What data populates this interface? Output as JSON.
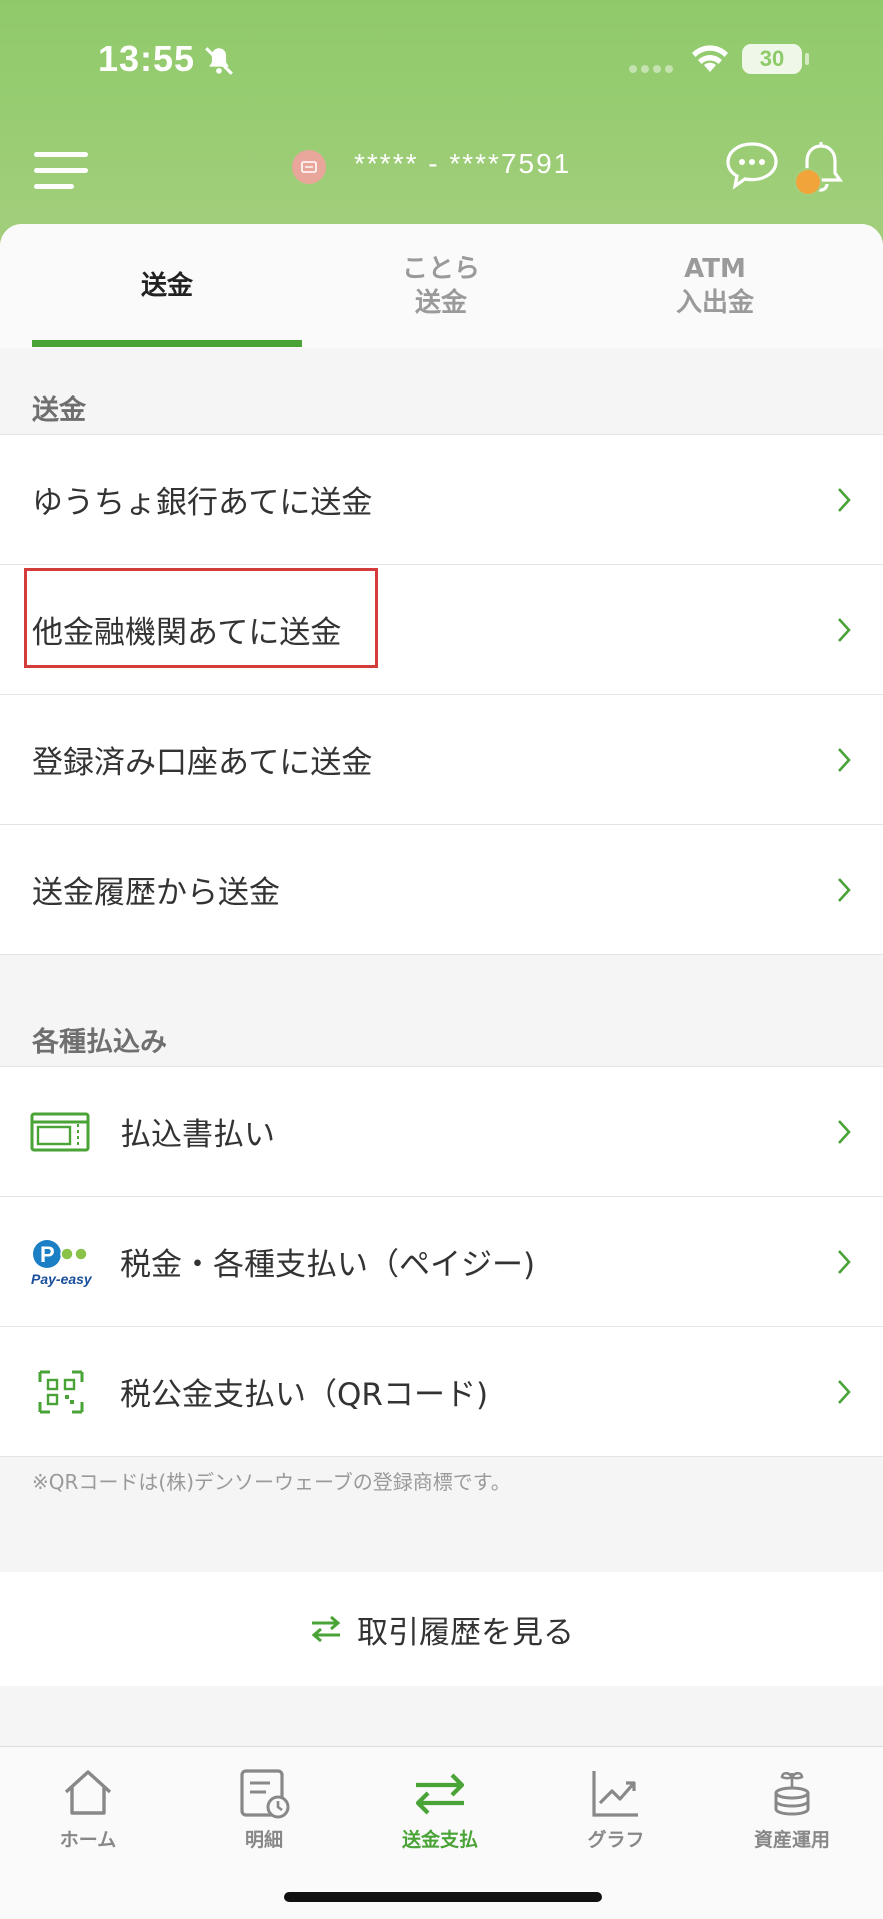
{
  "status_bar": {
    "time": "13:55",
    "battery": "30"
  },
  "header": {
    "account_number": "***** - ****7591"
  },
  "tabs": [
    {
      "label": "送金"
    },
    {
      "label": "ことら\n送金"
    },
    {
      "label": "ATM\n入出金"
    }
  ],
  "sections": {
    "transfer": {
      "title": "送金",
      "items": [
        {
          "label": "ゆうちょ銀行あてに送金"
        },
        {
          "label": "他金融機関あてに送金"
        },
        {
          "label": "登録済み口座あてに送金"
        },
        {
          "label": "送金履歴から送金"
        }
      ]
    },
    "payments": {
      "title": "各種払込み",
      "items": [
        {
          "label": "払込書払い",
          "icon": "payment-slip-icon"
        },
        {
          "label": "税金・各種支払い（ペイジー)",
          "icon": "pay-easy-logo"
        },
        {
          "label": "税公金支払い（QRコード)",
          "icon": "qr-code-icon"
        }
      ]
    }
  },
  "logo_text": "Pay-easy",
  "note": "※QRコードは(株)デンソーウェーブの登録商標です。",
  "history_link": {
    "label": "取引履歴を見る"
  },
  "bottom_nav": [
    {
      "label": "ホーム",
      "icon": "home-icon"
    },
    {
      "label": "明細",
      "icon": "statement-icon"
    },
    {
      "label": "送金支払",
      "icon": "transfer-icon"
    },
    {
      "label": "グラフ",
      "icon": "graph-icon"
    },
    {
      "label": "資産運用",
      "icon": "asset-icon"
    }
  ],
  "colors": {
    "accent": "#4aa336",
    "header": "#a4cf7d",
    "highlight": "#d43b3b",
    "notification": "#f0a43a"
  }
}
